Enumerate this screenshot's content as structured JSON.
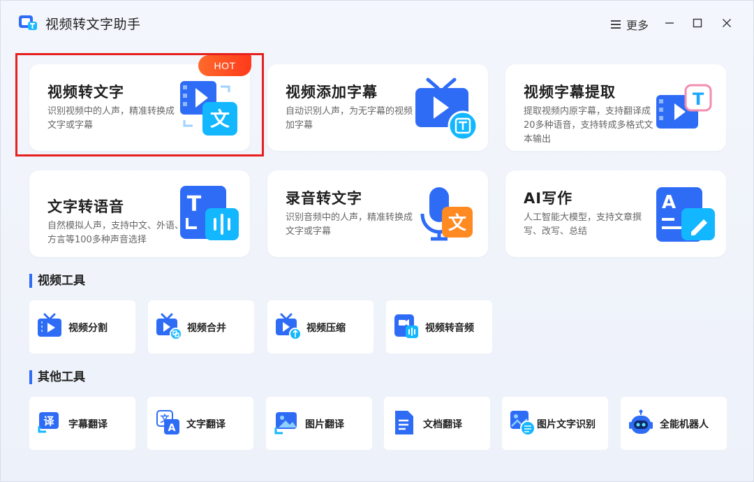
{
  "window": {
    "title": "视频转文字助手",
    "more_label": "更多"
  },
  "features": [
    {
      "title": "视频转文字",
      "desc": "识别视频中的人声，精准转换成文字或字幕",
      "badge": "HOT",
      "icon": "video-to-text-icon"
    },
    {
      "title": "视频添加字幕",
      "desc": "自动识别人声，为无字幕的视频加字幕",
      "icon": "tv-subtitle-icon"
    },
    {
      "title": "视频字幕提取",
      "desc": "提取视频内原字幕，支持翻译成20多种语音，支持转成多格式文本输出",
      "icon": "subtitle-extract-icon"
    },
    {
      "title": "文字转语音",
      "desc": "自然模拟人声，支持中文、外语、方言等100多种声音选择",
      "icon": "text-to-speech-icon"
    },
    {
      "title": "录音转文字",
      "desc": "识别音频中的人声，精准转换成文字或字幕",
      "icon": "mic-to-text-icon"
    },
    {
      "title": "AI写作",
      "desc": "人工智能大模型，支持文章撰写、改写、总结",
      "icon": "ai-write-icon"
    }
  ],
  "video_tools": {
    "heading": "视频工具",
    "items": [
      {
        "label": "视频分割",
        "icon": "video-split-icon"
      },
      {
        "label": "视频合并",
        "icon": "video-merge-icon"
      },
      {
        "label": "视频压缩",
        "icon": "video-compress-icon"
      },
      {
        "label": "视频转音频",
        "icon": "video-to-audio-icon"
      }
    ]
  },
  "other_tools": {
    "heading": "其他工具",
    "items": [
      {
        "label": "字幕翻译",
        "icon": "subtitle-translate-icon"
      },
      {
        "label": "文字翻译",
        "icon": "text-translate-icon"
      },
      {
        "label": "图片翻译",
        "icon": "image-translate-icon"
      },
      {
        "label": "文档翻译",
        "icon": "document-translate-icon"
      },
      {
        "label": "图片文字识别",
        "icon": "image-ocr-icon"
      },
      {
        "label": "全能机器人",
        "icon": "robot-icon"
      }
    ]
  },
  "icon_glyphs": {
    "text_glyph": "文",
    "t_glyph": "T",
    "a_glyph": "A",
    "translate_glyph": "译"
  },
  "colors": {
    "accent": "#2f6cf6",
    "hot": "#ff4a1f",
    "highlight": "#e5201f"
  }
}
